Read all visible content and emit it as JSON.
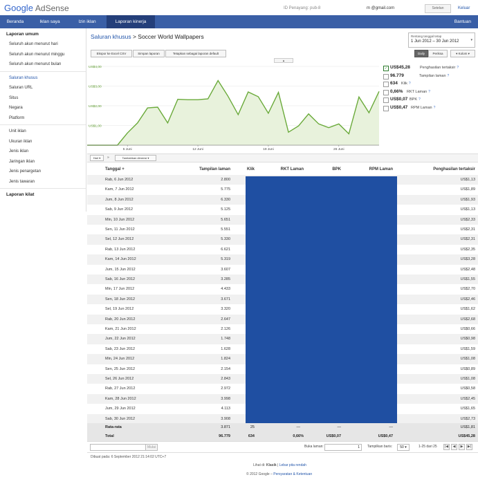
{
  "header": {
    "logo_google": "Google",
    "logo_product": "AdSense",
    "publisher_id": "ID Penayang: pub-8",
    "email": "m                       @gmail.com",
    "settings_label": "Setelan",
    "logout_label": "Keluar"
  },
  "nav": {
    "tabs": [
      {
        "label": "Beranda"
      },
      {
        "label": "Iklan saya"
      },
      {
        "label": "Izin iklan"
      },
      {
        "label": "Laporan kinerja"
      }
    ],
    "help": "Bantuan"
  },
  "sidebar": {
    "general_title": "Laporan umum",
    "general_items": [
      "Seluruh akun menurut hari",
      "Seluruh akun menurut minggu",
      "Seluruh akun menurut bulan"
    ],
    "channels_items": [
      "Saluran khusus",
      "Saluran URL",
      "Situs",
      "Negara",
      "Platform"
    ],
    "ad_items": [
      "Unit iklan",
      "Ukuran iklan",
      "Jenis iklan",
      "Jaringan iklan",
      "Jenis penargetan",
      "Jenis tawaran"
    ],
    "quick_title": "Laporan kilat"
  },
  "breadcrumb": {
    "parent": "Saluran khusus",
    "sep": " > ",
    "current": "Soccer World Wallpapers"
  },
  "actions": {
    "export": "Ekspor ke Excel CSV",
    "save": "Simpan laporan",
    "default": "Tetapkan sebagai laporan default"
  },
  "date_range": {
    "label": "Rentang tanggal tetap",
    "value": "1 Jun 2012 – 30 Jun 2012",
    "arrow": "▾"
  },
  "graph_buttons": {
    "daily": "Daily",
    "compare": "Periksa",
    "columns": "▾ Kolom ▾"
  },
  "collapse_handle": "▲",
  "metrics_panel": [
    {
      "value": "US$45,28",
      "label": "Penghasilan tertaksir",
      "checked": true
    },
    {
      "value": "96.779",
      "label": "Tampilan laman",
      "checked": false
    },
    {
      "value": "634",
      "label": "Klik",
      "checked": false
    },
    {
      "value": "0,66%",
      "label": "RKT Laman",
      "checked": false
    },
    {
      "value": "US$0,07",
      "label": "BPK",
      "checked": false
    },
    {
      "value": "US$0,47",
      "label": "RPM Laman",
      "checked": false
    }
  ],
  "help_glyph": "?",
  "check_glyph": "✓",
  "filter_bar": {
    "dimension": "Hari ▾",
    "sep": "»",
    "add_dimension": "Tambahkan dimensi ▾"
  },
  "chart_data": {
    "type": "area",
    "series": [
      {
        "name": "Penghasilan tertaksir",
        "color": "#6aaa3a"
      }
    ],
    "x": [
      "1 Jun",
      "2 Jun",
      "3 Jun",
      "4 Jun",
      "5 Jun",
      "6 Jun",
      "7 Jun",
      "8 Jun",
      "9 Jun",
      "10 Jun",
      "11 Jun",
      "12 Jun",
      "13 Jun",
      "14 Jun",
      "15 Jun",
      "16 Jun",
      "17 Jun",
      "18 Jun",
      "19 Jun",
      "20 Jun",
      "21 Jun",
      "22 Jun",
      "23 Jun",
      "24 Jun",
      "25 Jun",
      "26 Jun",
      "27 Jun",
      "28 Jun",
      "29 Jun",
      "30 Jun"
    ],
    "values": [
      0,
      0,
      0,
      0,
      0.62,
      1.13,
      1.89,
      1.93,
      1.13,
      2.33,
      2.31,
      2.31,
      2.35,
      3.28,
      2.48,
      1.55,
      2.7,
      2.46,
      1.62,
      2.68,
      0.66,
      0.98,
      1.59,
      1.08,
      0.89,
      1.08,
      0.58,
      2.45,
      1.65,
      2.73
    ],
    "y_ticks": [
      "US$4,00",
      "US$3,00",
      "US$2,00",
      "US$1,00"
    ],
    "x_ticks": [
      "5 Juni",
      "12 Juni",
      "19 Juni",
      "26 Juni"
    ],
    "ylim": [
      0,
      4
    ],
    "grid": true
  },
  "table": {
    "headers": [
      "Tanggal +",
      "Tampilan laman",
      "Klik",
      "RKT Laman",
      "BPK",
      "RPM Laman",
      "Penghasilan tertaksir"
    ],
    "rows": [
      [
        "Rab, 6 Jun 2012",
        "2.800",
        "US$1,13"
      ],
      [
        "Kam, 7 Jun 2012",
        "5.775",
        "US$1,89"
      ],
      [
        "Jum, 8 Jun 2012",
        "6.330",
        "US$1,93"
      ],
      [
        "Sab, 9 Jun 2012",
        "5.125",
        "US$1,13"
      ],
      [
        "Min, 10 Jun 2012",
        "5.651",
        "US$2,33"
      ],
      [
        "Sen, 11 Jun 2012",
        "5.551",
        "US$2,31"
      ],
      [
        "Sel, 12 Jun 2012",
        "5.330",
        "US$2,31"
      ],
      [
        "Rab, 13 Jun 2012",
        "6.621",
        "US$2,35"
      ],
      [
        "Kam, 14 Jun 2012",
        "5.319",
        "US$3,28"
      ],
      [
        "Jum, 15 Jun 2012",
        "3.607",
        "US$2,48"
      ],
      [
        "Sab, 16 Jun 2012",
        "3.285",
        "US$1,55"
      ],
      [
        "Min, 17 Jun 2012",
        "4.433",
        "US$2,70"
      ],
      [
        "Sen, 18 Jun 2012",
        "3.671",
        "US$2,46"
      ],
      [
        "Sel, 19 Jun 2012",
        "3.320",
        "US$1,62"
      ],
      [
        "Rab, 20 Jun 2012",
        "2.647",
        "US$2,68"
      ],
      [
        "Kam, 21 Jun 2012",
        "2.126",
        "US$0,66"
      ],
      [
        "Jum, 22 Jun 2012",
        "1.748",
        "US$0,98"
      ],
      [
        "Sab, 23 Jun 2012",
        "1.628",
        "US$1,59"
      ],
      [
        "Min, 24 Jun 2012",
        "1.824",
        "US$1,08"
      ],
      [
        "Sen, 25 Jun 2012",
        "2.154",
        "US$0,89"
      ],
      [
        "Sel, 26 Jun 2012",
        "2.843",
        "US$1,08"
      ],
      [
        "Rab, 27 Jun 2012",
        "2.972",
        "US$0,58"
      ],
      [
        "Kam, 28 Jun 2012",
        "3.998",
        "US$2,45"
      ],
      [
        "Jum, 29 Jun 2012",
        "4.113",
        "US$1,65"
      ],
      [
        "Sab, 30 Jun 2012",
        "3.908",
        "US$2,73"
      ]
    ],
    "average": {
      "label": "Rata-rata",
      "pageviews": "3.871",
      "clicks": "25",
      "ctr": "—",
      "cpc": "—",
      "rpm": "—",
      "earnings": "US$1,81"
    },
    "total": {
      "label": "Total",
      "pageviews": "96.779",
      "clicks": "634",
      "ctr": "0,66%",
      "cpc": "US$0,07",
      "rpm": "US$0,47",
      "earnings": "US$45,28"
    }
  },
  "pager": {
    "filter_placeholder": "",
    "filter_button": "Mulai",
    "goto_label": "Buka laman:",
    "goto_value": "1",
    "rows_label": "Tampilkan baris:",
    "rows_value": "50 ▾",
    "range_text": "1-25 dari 25"
  },
  "footer": {
    "created": "Dibuat pada: 6 September 2012 21:14:02 UTC+7",
    "view_prefix": "Lihat di:",
    "view_classic": "Klasik",
    "view_sep": "|",
    "view_light": "Lebar pita rendah",
    "copyright": "© 2012 Google –",
    "terms": "Persyaratan & Ketentuan"
  }
}
